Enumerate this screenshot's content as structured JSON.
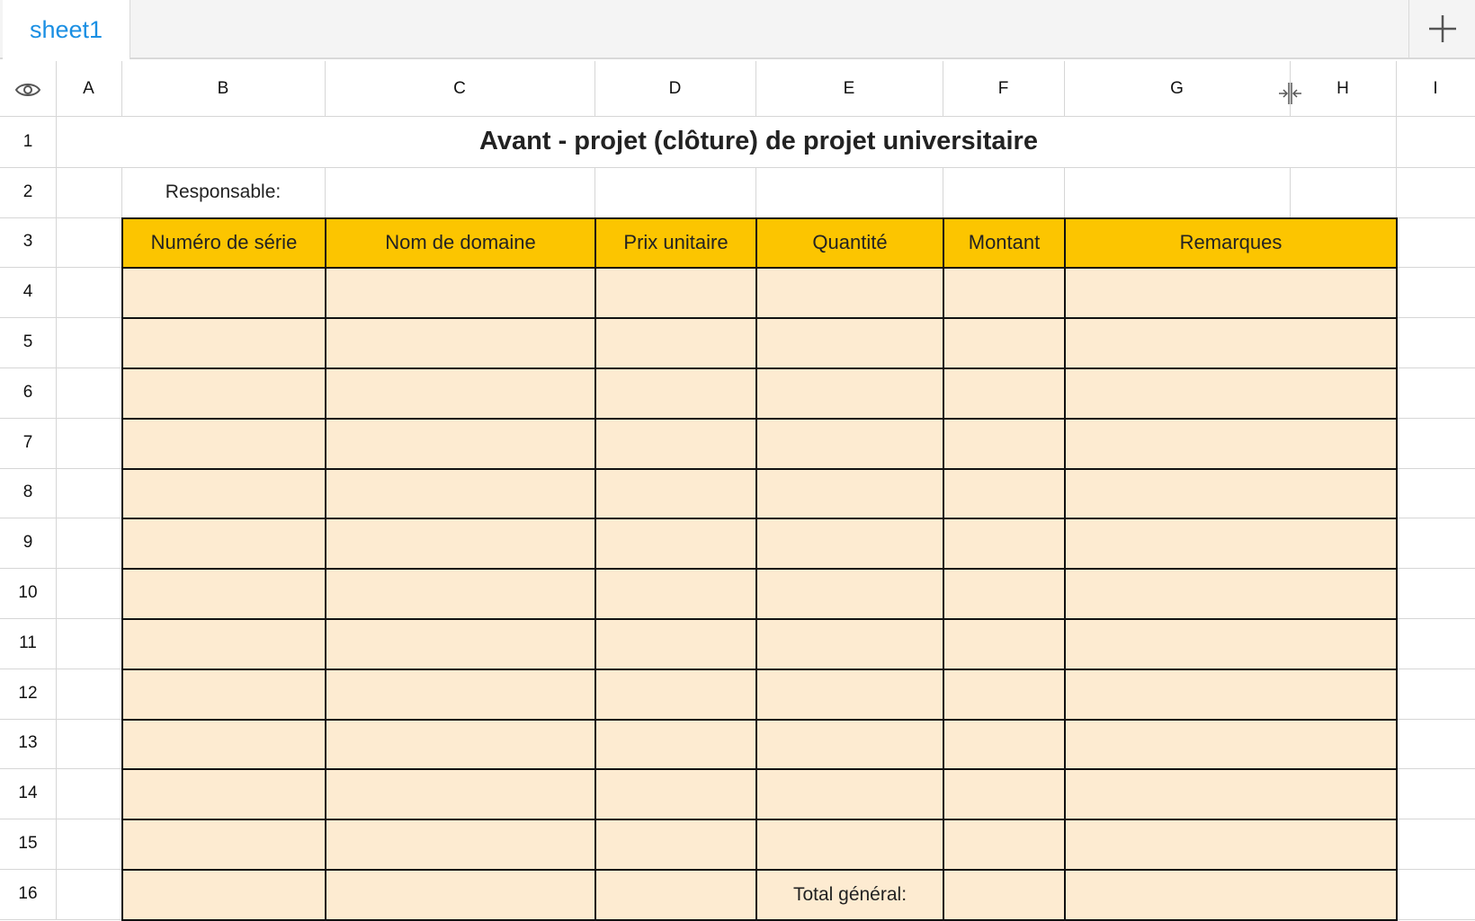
{
  "tabs": {
    "active": "sheet1",
    "add_icon": "plus-icon"
  },
  "columns": [
    "A",
    "B",
    "C",
    "D",
    "E",
    "F",
    "G",
    "H",
    "I"
  ],
  "rows": [
    "1",
    "2",
    "3",
    "4",
    "5",
    "6",
    "7",
    "8",
    "9",
    "10",
    "11",
    "12",
    "13",
    "14",
    "15",
    "16"
  ],
  "sheet": {
    "title": "Avant - projet (clôture) de projet universitaire",
    "responsable_label": "Responsable:",
    "headers": [
      "Numéro de série",
      "Nom de domaine",
      "Prix unitaire",
      "Quantité",
      "Montant",
      "Remarques"
    ],
    "total_label": "Total général:"
  },
  "colors": {
    "header_fill": "#fcc500",
    "body_fill": "#fdebd1",
    "tab_text": "#1a8fe3"
  }
}
